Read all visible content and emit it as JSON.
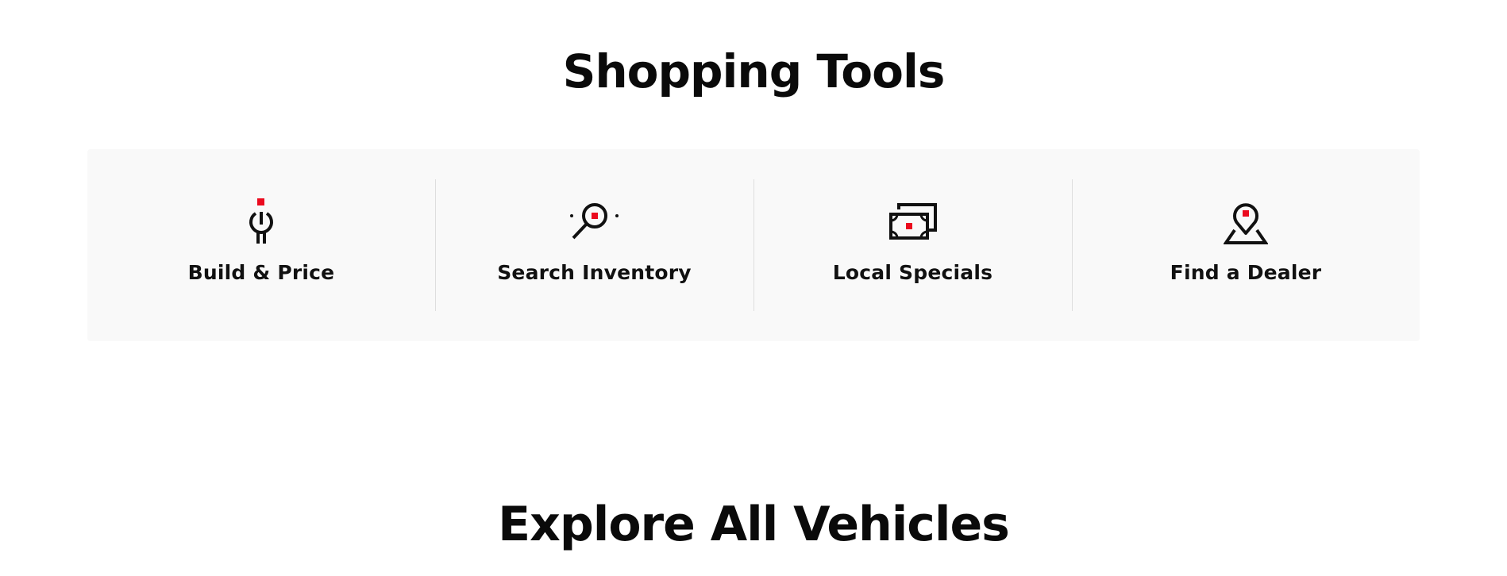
{
  "shopping_tools": {
    "title": "Shopping Tools",
    "items": [
      {
        "label": "Build & Price",
        "icon": "build-price-icon"
      },
      {
        "label": "Search Inventory",
        "icon": "magnifier-icon"
      },
      {
        "label": "Local Specials",
        "icon": "money-icon"
      },
      {
        "label": "Find a Dealer",
        "icon": "map-pin-icon"
      }
    ]
  },
  "explore": {
    "title": "Explore All Vehicles"
  },
  "colors": {
    "accent": "#eb0a1e",
    "text": "#0a0a0a",
    "panel_bg": "#f9f9f9",
    "divider": "#dedede"
  }
}
